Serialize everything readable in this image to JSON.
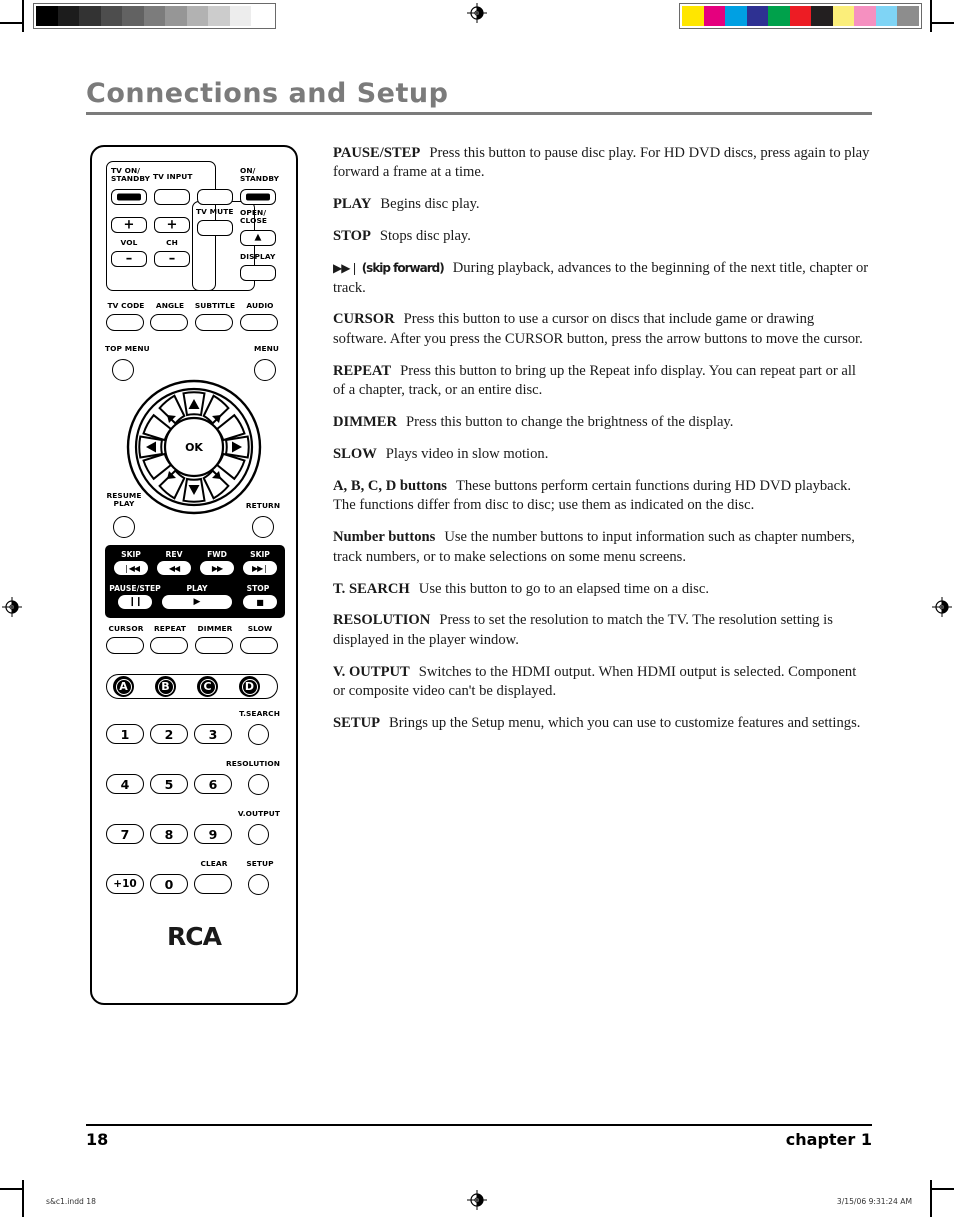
{
  "document": {
    "header_title": "Connections and Setup",
    "footer": {
      "page_number": "18",
      "chapter_label": "chapter 1",
      "slug_left": "s&c1.indd   18",
      "slug_right": "3/15/06   9:31:24 AM"
    }
  },
  "print_marks": {
    "gray_wedge": [
      "#000000",
      "#1c1c1c",
      "#333333",
      "#4d4d4d",
      "#626262",
      "#7c7c7c",
      "#969696",
      "#b2b2b2",
      "#cccccc",
      "#ededed",
      "#ffffff"
    ],
    "color_bars": [
      "#ffe600",
      "#e5007e",
      "#00a0e3",
      "#2e3192",
      "#00a14b",
      "#ed1c24",
      "#231f20",
      "#fbee7a",
      "#f590c0",
      "#7fd4f5",
      "#8d8d8d"
    ]
  },
  "descriptions": [
    {
      "term": "PAUSE/STEP",
      "text": "Press this button to pause disc play. For HD DVD discs, press again to play forward a frame at a time."
    },
    {
      "term": "PLAY",
      "text": "Begins disc play."
    },
    {
      "term": "STOP",
      "text": "Stops disc play."
    },
    {
      "term": "▶▶❘ (skip forward)",
      "text": "During playback, advances to the beginning of  the next title, chapter or track."
    },
    {
      "term": "CURSOR",
      "text": "Press this button to use a cursor on discs that include game or drawing software. After you press the CURSOR button, press the arrow buttons to move the cursor."
    },
    {
      "term": "REPEAT",
      "text": "Press this button to bring up the Repeat info display. You can repeat part or all of a chapter, track, or an entire disc."
    },
    {
      "term": "DIMMER",
      "text": "Press this button to change the brightness of the display."
    },
    {
      "term": "SLOW",
      "text": "Plays video in slow motion."
    },
    {
      "term": "A, B, C, D buttons",
      "text": "These buttons perform certain functions during HD DVD playback. The functions differ from disc to disc; use them as indicated on the disc."
    },
    {
      "term": "Number buttons",
      "text": "Use the number buttons to input information such as chapter numbers, track numbers, or to make selections on some menu screens."
    },
    {
      "term": "T. SEARCH",
      "text": "Use this button to go to an elapsed time on a disc."
    },
    {
      "term": "RESOLUTION",
      "text": "Press to set the resolution to match the TV. The resolution setting is displayed in the player window."
    },
    {
      "term": "V. OUTPUT",
      "text": "Switches to the HDMI output. When HDMI output is selected. Component or composite video can't be displayed."
    },
    {
      "term": "SETUP",
      "text": "Brings up the Setup menu, which you can use to customize features and settings."
    }
  ],
  "remote": {
    "brand": "RCA",
    "labels": {
      "tv_on_standby": "TV ON/\nSTANDBY",
      "tv_input": "TV INPUT",
      "on_standby": "ON/\nSTANDBY",
      "tv_mute": "TV MUTE",
      "open_close": "OPEN/\nCLOSE",
      "display": "DISPLAY",
      "vol": "VOL",
      "ch": "CH",
      "tv_code": "TV CODE",
      "angle": "ANGLE",
      "subtitle": "SUBTITLE",
      "audio": "AUDIO",
      "top_menu": "TOP MENU",
      "menu": "MENU",
      "ok": "OK",
      "resume_play": "RESUME\nPLAY",
      "return": "RETURN",
      "skip_back": "SKIP",
      "rev": "REV",
      "fwd": "FWD",
      "skip_fwd": "SKIP",
      "pause_step": "PAUSE/STEP",
      "play": "PLAY",
      "stop": "STOP",
      "cursor": "CURSOR",
      "repeat": "REPEAT",
      "dimmer": "DIMMER",
      "slow": "SLOW",
      "t_search": "T.SEARCH",
      "resolution": "RESOLUTION",
      "v_output": "V.OUTPUT",
      "clear": "CLEAR",
      "setup": "SETUP"
    },
    "color_keys": {
      "a": "A",
      "b": "B",
      "c": "C",
      "d": "D"
    },
    "number_keys": [
      "1",
      "2",
      "3",
      "4",
      "5",
      "6",
      "7",
      "8",
      "9",
      "+10",
      "0"
    ],
    "transport_glyphs": {
      "skip_back": "❘◀◀",
      "rev": "◀◀",
      "fwd": "▶▶",
      "skip_fwd": "▶▶❘",
      "pause": "❙❙",
      "play": "▶",
      "stop": "■"
    },
    "eject_glyph": "▲"
  }
}
